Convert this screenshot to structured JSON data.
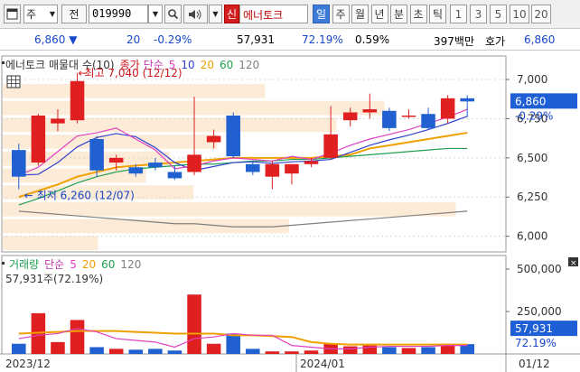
{
  "toolbar": {
    "type_label": "주",
    "prev_label": "전",
    "code": "019990",
    "new_badge": "신",
    "stock_name": "에너토크",
    "periods": [
      "일",
      "주",
      "월",
      "년",
      "분",
      "초",
      "틱"
    ],
    "active_period": "일",
    "numbers": [
      "1",
      "3",
      "5",
      "10",
      "20"
    ]
  },
  "quote": {
    "price": "6,860",
    "change": "20",
    "change_pct": "-0.29%",
    "volume": "57,931",
    "volume_ratio": "72.19%",
    "turnover": "0.59%",
    "amount": "397백만",
    "ask_label": "호가",
    "ask_price": "6,860"
  },
  "price_panel": {
    "legend_title": "에너토크 매물대 수(10)",
    "legend_close": "종가",
    "legend_ma": "단순",
    "ma_periods": [
      "5",
      "10",
      "20",
      "60",
      "120"
    ],
    "high_label": "최고 7,040 (12/12)",
    "low_label": "최저 6,260 (12/07)",
    "y_ticks": [
      "7,000",
      "6,750",
      "6,500",
      "6,250",
      "6,000"
    ],
    "current_price_label": "6,860",
    "current_pct_label": "-0.29%"
  },
  "volume_panel": {
    "legend_title": "거래량",
    "legend_ma": "단순",
    "ma_periods": [
      "5",
      "20",
      "60",
      "120"
    ],
    "volume_note": "57,931주(72.19%)",
    "y_ticks": [
      "500,000",
      "250,000"
    ],
    "current_volume_label": "57,931",
    "current_pct_label": "72.19%"
  },
  "x_axis": {
    "labels": [
      "2023/12",
      "2024/01",
      "01/12"
    ]
  },
  "chart_data": {
    "type": "candlestick",
    "candles": [
      {
        "o": 6550,
        "h": 6590,
        "l": 6300,
        "c": 6380
      },
      {
        "o": 6470,
        "h": 6780,
        "l": 6450,
        "c": 6770
      },
      {
        "o": 6720,
        "h": 6810,
        "l": 6670,
        "c": 6750
      },
      {
        "o": 6740,
        "h": 7040,
        "l": 6720,
        "c": 6990
      },
      {
        "o": 6620,
        "h": 6640,
        "l": 6380,
        "c": 6420
      },
      {
        "o": 6470,
        "h": 6520,
        "l": 6420,
        "c": 6500
      },
      {
        "o": 6440,
        "h": 6460,
        "l": 6380,
        "c": 6400
      },
      {
        "o": 6470,
        "h": 6500,
        "l": 6420,
        "c": 6440
      },
      {
        "o": 6410,
        "h": 6450,
        "l": 6360,
        "c": 6370
      },
      {
        "o": 6410,
        "h": 6890,
        "l": 6390,
        "c": 6520
      },
      {
        "o": 6600,
        "h": 6680,
        "l": 6560,
        "c": 6640
      },
      {
        "o": 6770,
        "h": 6790,
        "l": 6500,
        "c": 6510
      },
      {
        "o": 6460,
        "h": 6480,
        "l": 6390,
        "c": 6410
      },
      {
        "o": 6380,
        "h": 6480,
        "l": 6300,
        "c": 6460
      },
      {
        "o": 6400,
        "h": 6460,
        "l": 6330,
        "c": 6460
      },
      {
        "o": 6460,
        "h": 6500,
        "l": 6440,
        "c": 6480
      },
      {
        "o": 6500,
        "h": 6830,
        "l": 6490,
        "c": 6650
      },
      {
        "o": 6740,
        "h": 6820,
        "l": 6700,
        "c": 6790
      },
      {
        "o": 6790,
        "h": 6910,
        "l": 6750,
        "c": 6810
      },
      {
        "o": 6800,
        "h": 6820,
        "l": 6670,
        "c": 6690
      },
      {
        "o": 6770,
        "h": 6810,
        "l": 6750,
        "c": 6770
      },
      {
        "o": 6780,
        "h": 6820,
        "l": 6680,
        "c": 6690
      },
      {
        "o": 6750,
        "h": 6900,
        "l": 6720,
        "c": 6880
      },
      {
        "o": 6880,
        "h": 6900,
        "l": 6760,
        "c": 6860
      }
    ],
    "volume": [
      60000,
      240000,
      70000,
      200000,
      40000,
      30000,
      25000,
      30000,
      20000,
      350000,
      60000,
      120000,
      30000,
      15000,
      15000,
      20000,
      60000,
      45000,
      50000,
      40000,
      35000,
      40000,
      60000,
      57931
    ],
    "ma5": [
      6390,
      6440,
      6540,
      6640,
      6660,
      6690,
      6620,
      6550,
      6430,
      6450,
      6480,
      6500,
      6490,
      6480,
      6510,
      6490,
      6530,
      6580,
      6620,
      6650,
      6680,
      6720,
      6760,
      6810
    ],
    "ma20": [
      6250,
      6290,
      6330,
      6380,
      6410,
      6440,
      6450,
      6460,
      6470,
      6480,
      6490,
      6500,
      6500,
      6500,
      6500,
      6500,
      6510,
      6520,
      6560,
      6580,
      6600,
      6620,
      6640,
      6660
    ],
    "ma60": [
      6200,
      6240,
      6290,
      6340,
      6380,
      6410,
      6430,
      6440,
      6450,
      6460,
      6460,
      6470,
      6480,
      6480,
      6490,
      6490,
      6500,
      6510,
      6520,
      6530,
      6540,
      6550,
      6560,
      6560
    ],
    "ma120": [
      6160,
      6150,
      6140,
      6130,
      6120,
      6110,
      6100,
      6090,
      6080,
      6080,
      6070,
      6060,
      6060,
      6060,
      6070,
      6080,
      6090,
      6100,
      6110,
      6120,
      6130,
      6140,
      6150,
      6160
    ],
    "vol_ma5": [
      90000,
      110000,
      120000,
      150000,
      130000,
      90000,
      80000,
      70000,
      40000,
      90000,
      100000,
      120000,
      110000,
      110000,
      50000,
      40000,
      30000,
      30000,
      40000,
      45000,
      45000,
      45000,
      50000,
      50000
    ],
    "vol_ma20": [
      120000,
      125000,
      130000,
      135000,
      135000,
      135000,
      130000,
      125000,
      120000,
      120000,
      120000,
      110000,
      110000,
      105000,
      100000,
      70000,
      60000,
      55000,
      55000,
      55000,
      55000,
      55000,
      55000,
      55000
    ],
    "price_range": [
      5900,
      7150
    ],
    "volume_range": [
      0,
      580000
    ],
    "colors": {
      "up": "#e02020",
      "down": "#2060d0",
      "ma5": "#e040c0",
      "ma10": "#3040d0",
      "ma20": "#f0a000",
      "ma60": "#20a050",
      "ma120": "#808080"
    }
  }
}
